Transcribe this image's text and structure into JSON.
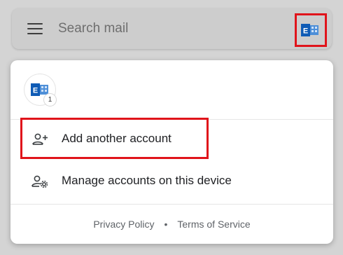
{
  "search": {
    "placeholder": "Search mail",
    "menu_icon": "hamburger-menu-icon",
    "account_icon": "exchange-icon"
  },
  "account_menu": {
    "avatar_icon": "exchange-icon",
    "badge_count": "1",
    "actions": [
      {
        "label": "Add another account",
        "icon": "add-person-icon"
      },
      {
        "label": "Manage accounts on this device",
        "icon": "manage-accounts-icon"
      }
    ],
    "footer": {
      "privacy": "Privacy Policy",
      "separator": "•",
      "terms": "Terms of Service"
    }
  },
  "colors": {
    "highlight": "#e0141b",
    "exchange_blue": "#0f5bb5",
    "backdrop": "#d4d4d4"
  }
}
